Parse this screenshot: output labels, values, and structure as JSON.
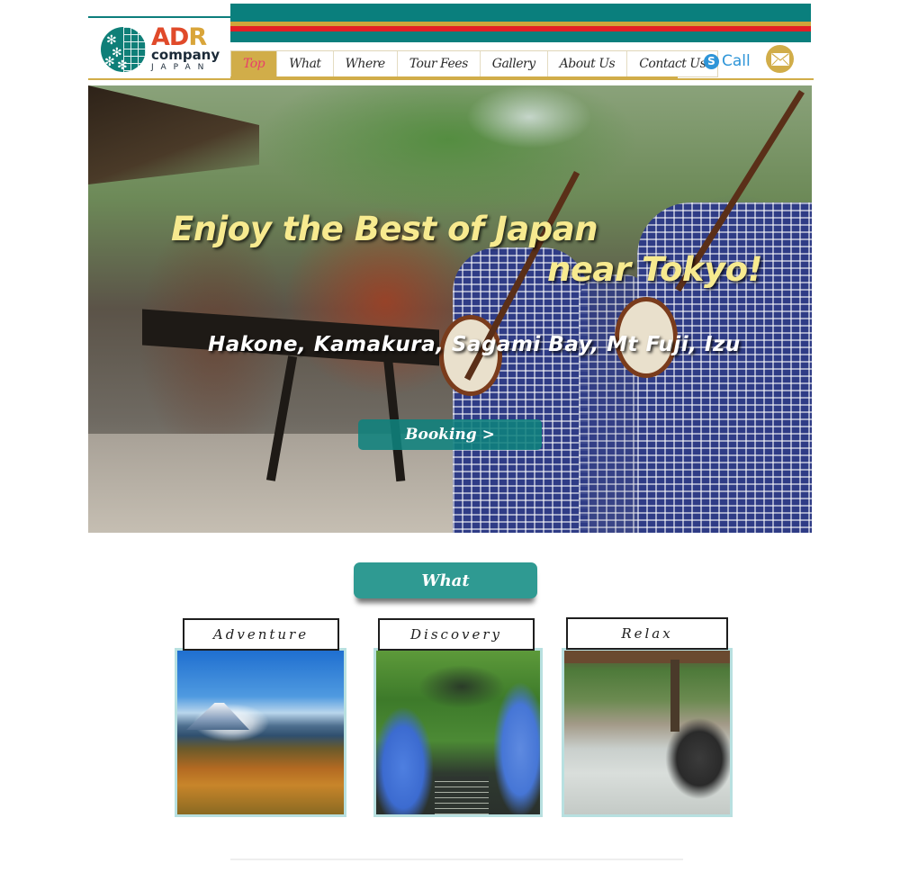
{
  "brand": {
    "logo_main": [
      "A",
      "D",
      "R"
    ],
    "logo_company": "company",
    "logo_country": "JAPAN",
    "colors": {
      "teal": "#0a7f7d",
      "gold": "#d1ad49",
      "red": "#e31e25",
      "active_text": "#e8406a",
      "skype_blue": "#2e95d8",
      "headline_yellow": "#f7ea8f"
    }
  },
  "nav": {
    "items": [
      {
        "label": "Top",
        "active": true
      },
      {
        "label": "What",
        "active": false
      },
      {
        "label": "Where",
        "active": false
      },
      {
        "label": "Tour Fees",
        "active": false
      },
      {
        "label": "Gallery",
        "active": false
      },
      {
        "label": "About Us",
        "active": false
      },
      {
        "label": "Contact Us",
        "active": false
      }
    ],
    "call_label": "Call",
    "skype_glyph": "S",
    "mail_icon": "envelope-icon"
  },
  "hero": {
    "title_line1": "Enjoy the Best of Japan",
    "title_line2": "near Tokyo!",
    "subtitle": "Hakone, Kamakura, Sagami Bay, Mt Fuji, Izu",
    "booking_label": "Booking >"
  },
  "what": {
    "button_label": "What",
    "cards": [
      {
        "label": "Adventure",
        "photo": "mt-fuji-autumn-lake"
      },
      {
        "label": "Discovery",
        "photo": "hydrangea-stone-steps"
      },
      {
        "label": "Relax",
        "photo": "outdoor-hot-spring"
      }
    ]
  }
}
